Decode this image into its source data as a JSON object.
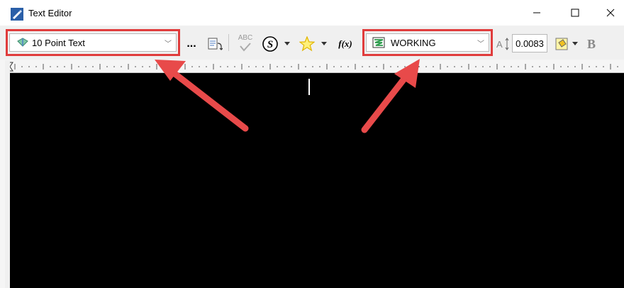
{
  "window": {
    "title": "Text Editor"
  },
  "window_controls": {
    "minimize": "—",
    "maximize": "☐",
    "close": "✕"
  },
  "toolbar": {
    "text_style": {
      "value": "10 Point Text"
    },
    "more_button": "...",
    "spell_check_label": "ABC",
    "function_label": "f(x)",
    "level": {
      "value": "WORKING"
    },
    "text_height": {
      "value": "0.0083"
    },
    "bold_label": "B"
  },
  "colors": {
    "highlight": "#e03c3c",
    "editor_background": "#000000"
  },
  "icons": [
    "app-icon",
    "text-style-icon",
    "insert-field-icon",
    "spell-check-icon",
    "symbol-icon",
    "favorite-star-icon",
    "function-icon",
    "level-icon",
    "text-height-icon",
    "fill-color-icon",
    "bold-icon"
  ]
}
